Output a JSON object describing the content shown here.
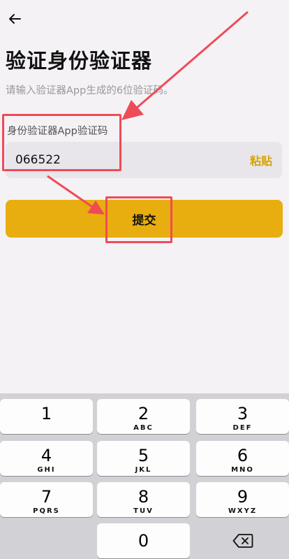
{
  "header": {
    "back_icon": "arrow-left-icon",
    "title": "验证身份验证器",
    "subtitle": "请输入验证器App生成的6位验证码。"
  },
  "form": {
    "label": "身份验证器App验证码",
    "code_value": "066522",
    "paste_label": "粘贴",
    "submit_label": "提交"
  },
  "colors": {
    "background": "#f4f2f5",
    "accent": "#e8ad0e",
    "paste_text": "#d9a300",
    "annotation": "#ef4b57"
  },
  "keyboard": {
    "keys": [
      {
        "num": "1",
        "letters": ""
      },
      {
        "num": "2",
        "letters": "ABC"
      },
      {
        "num": "3",
        "letters": "DEF"
      },
      {
        "num": "4",
        "letters": "GHI"
      },
      {
        "num": "5",
        "letters": "JKL"
      },
      {
        "num": "6",
        "letters": "MNO"
      },
      {
        "num": "7",
        "letters": "PQRS"
      },
      {
        "num": "8",
        "letters": "TUV"
      },
      {
        "num": "9",
        "letters": "WXYZ"
      },
      {
        "num": "0",
        "letters": ""
      }
    ],
    "delete_icon": "backspace-icon"
  }
}
